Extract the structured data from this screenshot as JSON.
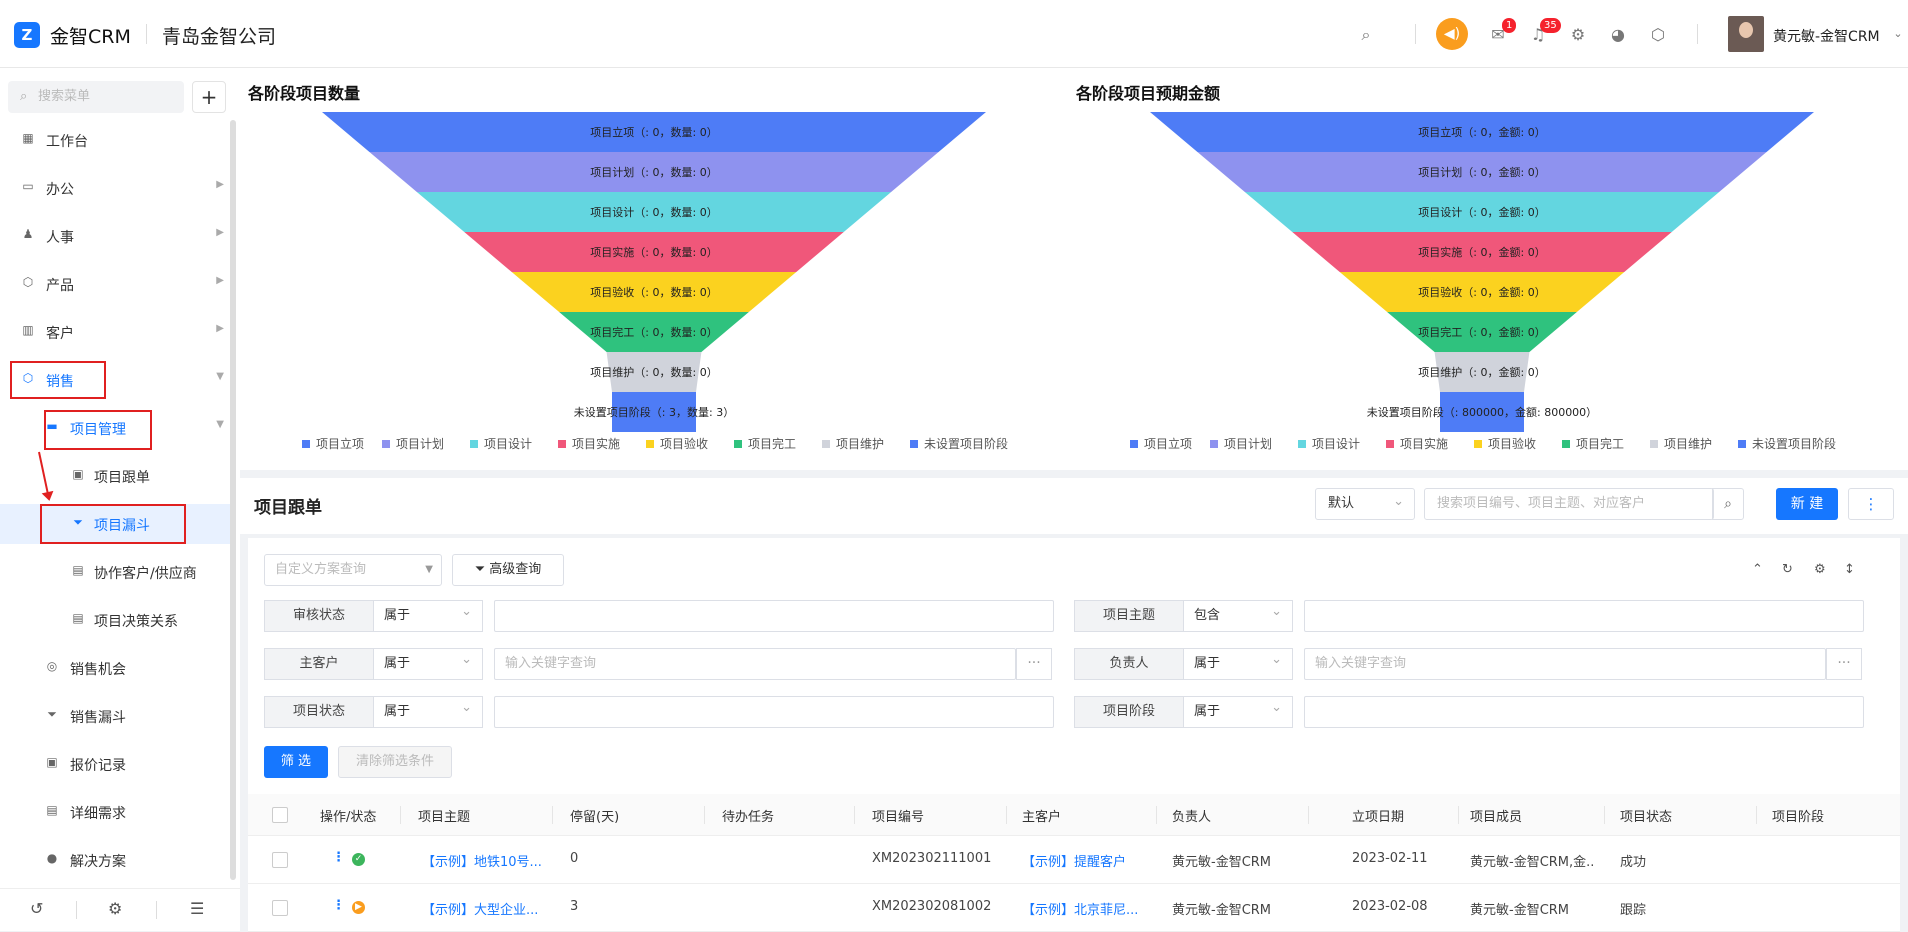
{
  "app": {
    "logo_mark": "Z",
    "name": "金智CRM",
    "company": "青岛金智公司"
  },
  "header": {
    "notif_badge_1": "1",
    "notif_badge_2": "35",
    "username": "黄元敏-金智CRM",
    "icons": [
      "search-icon",
      "speaker-icon",
      "inbox-icon",
      "bell-icon",
      "gear-icon",
      "pie-chart-icon",
      "cube-icon"
    ]
  },
  "sidebar": {
    "search_placeholder": "搜索菜单",
    "plus": "+",
    "items": [
      {
        "label": "工作台",
        "icon": "dashboard-icon",
        "glyph": "▦"
      },
      {
        "label": "办公",
        "icon": "monitor-icon",
        "glyph": "▭"
      },
      {
        "label": "人事",
        "icon": "people-icon",
        "glyph": "♟"
      },
      {
        "label": "产品",
        "icon": "box-icon",
        "glyph": "⬡"
      },
      {
        "label": "客户",
        "icon": "bar-icon",
        "glyph": "▥"
      },
      {
        "label": "销售",
        "icon": "sales-icon",
        "glyph": "⬡"
      },
      {
        "label": "项目管理",
        "icon": "folder-icon",
        "glyph": "▬"
      },
      {
        "label": "项目跟单",
        "icon": "doc-icon",
        "glyph": "▣"
      },
      {
        "label": "项目漏斗",
        "icon": "funnel-icon",
        "glyph": "⏷"
      },
      {
        "label": "协作客户/供应商",
        "icon": "list-icon",
        "glyph": "▤"
      },
      {
        "label": "项目决策关系",
        "icon": "list-icon",
        "glyph": "▤"
      },
      {
        "label": "销售机会",
        "icon": "target-icon",
        "glyph": "◎"
      },
      {
        "label": "销售漏斗",
        "icon": "funnel-icon",
        "glyph": "⏷"
      },
      {
        "label": "报价记录",
        "icon": "record-icon",
        "glyph": "▣"
      },
      {
        "label": "详细需求",
        "icon": "file-icon",
        "glyph": "▤"
      },
      {
        "label": "解决方案",
        "icon": "bulb-icon",
        "glyph": "●"
      }
    ],
    "bottom_icons": [
      "history-icon",
      "sliders-icon",
      "collapse-icon"
    ]
  },
  "funnels": [
    {
      "title": "各阶段项目数量",
      "stages": [
        {
          "label": "项目立项（: 0，数量: 0）"
        },
        {
          "label": "项目计划（: 0，数量: 0）"
        },
        {
          "label": "项目设计（: 0，数量: 0）"
        },
        {
          "label": "项目实施（: 0，数量: 0）"
        },
        {
          "label": "项目验收（: 0，数量: 0）"
        },
        {
          "label": "项目完工（: 0，数量: 0）"
        },
        {
          "label": "项目维护（: 0，数量: 0）"
        },
        {
          "label": "未设置项目阶段（: 3，数量: 3）"
        }
      ]
    },
    {
      "title": "各阶段项目预期金额",
      "stages": [
        {
          "label": "项目立项（: 0，金额: 0）"
        },
        {
          "label": "项目计划（: 0，金额: 0）"
        },
        {
          "label": "项目设计（: 0，金额: 0）"
        },
        {
          "label": "项目实施（: 0，金额: 0）"
        },
        {
          "label": "项目验收（: 0，金额: 0）"
        },
        {
          "label": "项目完工（: 0，金额: 0）"
        },
        {
          "label": "项目维护（: 0，金额: 0）"
        },
        {
          "label": "未设置项目阶段（: 800000，金额: 800000）"
        }
      ]
    }
  ],
  "legend": [
    {
      "label": "项目立项",
      "color": "#4e7cf6"
    },
    {
      "label": "项目计划",
      "color": "#8e92ef"
    },
    {
      "label": "项目设计",
      "color": "#63d6e0"
    },
    {
      "label": "项目实施",
      "color": "#f0577a"
    },
    {
      "label": "项目验收",
      "color": "#fbd21f"
    },
    {
      "label": "项目完工",
      "color": "#2fc27e"
    },
    {
      "label": "项目维护",
      "color": "#d0d3db"
    },
    {
      "label": "未设置项目阶段",
      "color": "#4e7cf6"
    }
  ],
  "stage_colors": [
    "#4e7cf6",
    "#8e92ef",
    "#63d6e0",
    "#f0577a",
    "#fbd21f",
    "#2fc27e",
    "#d0d3db",
    "#4e7cf6"
  ],
  "project_list": {
    "title": "项目跟单",
    "view_select": "默认",
    "search_placeholder": "搜索项目编号、项目主题、对应客户",
    "new_button": "新 建",
    "more_button": "⋮"
  },
  "filters": {
    "scheme_placeholder": "自定义方案查询",
    "advanced": "高级查询",
    "rows": [
      {
        "left_label": "审核状态",
        "left_op": "属于",
        "left_value": "",
        "right_label": "项目主题",
        "right_op": "包含",
        "right_value": ""
      },
      {
        "left_label": "主客户",
        "left_op": "属于",
        "left_value": "输入关键字查询",
        "right_label": "负责人",
        "right_op": "属于",
        "right_value": "输入关键字查询"
      },
      {
        "left_label": "项目状态",
        "left_op": "属于",
        "left_value": "",
        "right_label": "项目阶段",
        "right_op": "属于",
        "right_value": ""
      }
    ],
    "apply": "筛 选",
    "clear": "清除筛选条件"
  },
  "table": {
    "columns": [
      "操作/状态",
      "项目主题",
      "停留(天)",
      "待办任务",
      "项目编号",
      "主客户",
      "负责人",
      "立项日期",
      "项目成员",
      "项目状态",
      "项目阶段"
    ],
    "rows": [
      {
        "status": "success",
        "subject": "【示例】地铁10号...",
        "stay": "0",
        "todo": "",
        "code": "XM202302111001",
        "customer": "【示例】提醒客户",
        "owner": "黄元敏-金智CRM",
        "date": "2023-02-11",
        "members": "黄元敏-金智CRM,金...",
        "state": "成功",
        "stage": ""
      },
      {
        "status": "tracking",
        "subject": "【示例】大型企业...",
        "stay": "3",
        "todo": "",
        "code": "XM202302081002",
        "customer": "【示例】北京菲尼...",
        "owner": "黄元敏-金智CRM",
        "date": "2023-02-08",
        "members": "黄元敏-金智CRM",
        "state": "跟踪",
        "stage": ""
      }
    ]
  }
}
